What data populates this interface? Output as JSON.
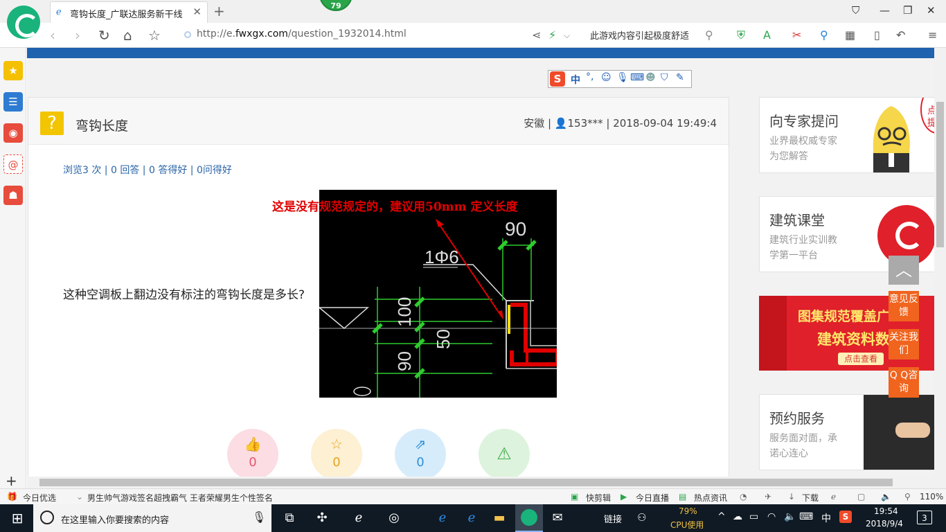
{
  "browser": {
    "tab_title": "弯钩长度_广联达服务新干线",
    "badge": "79",
    "url_prefix": "http://e.",
    "url_domain": "fwxgx.com",
    "url_path": "/question_1932014.html",
    "search_text": "此游戏内容引起极度舒适"
  },
  "question": {
    "title": "弯钩长度",
    "region": "安徽",
    "user": "153***",
    "datetime": "2018-09-04 19:49:4",
    "views": "浏览3 次",
    "answers": "0 回答",
    "good_answers": "0 答得好",
    "good_questions": "0问得好",
    "body": "这种空调板上翻边没有标注的弯钩长度是多长?",
    "annotation": "这是没有规范规定的，建议用50mm 定义长度",
    "like_count": "0",
    "fav_count": "0",
    "share_count": "0"
  },
  "cad": {
    "dim_90_top": "90",
    "rebar_label": "1Φ6",
    "dim_100": "100",
    "dim_50": "50",
    "dim_90_left": "90"
  },
  "sidebar_cards": [
    {
      "title": "向专家提问",
      "sub1": "业界最权威专家",
      "sub2": "为您解答"
    },
    {
      "title": "建筑课堂",
      "sub1": "建筑行业实训教",
      "sub2": "学第一平台"
    },
    {
      "title": "预约服务",
      "sub1": "服务面对面，承",
      "sub2": "诺心连心"
    }
  ],
  "mascot_bubble": "点击\n提问",
  "banner": {
    "line1": "图集规范覆盖广",
    "line2": "建筑资料数",
    "cta": "点击查看"
  },
  "float_buttons": {
    "feedback": "意见反馈",
    "follow": "关注我们",
    "qq": "Q Q咨询"
  },
  "statusbar": {
    "today": "今日优选",
    "headline": "男生帅气游戏签名超拽霸气 王者荣耀男生个性签名",
    "clip": "快剪辑",
    "live": "今日直播",
    "news": "热点资讯",
    "download": "下载",
    "zoom": "110%"
  },
  "taskbar": {
    "search_placeholder": "在这里输入你要搜索的内容",
    "link": "链接",
    "cpu_pct": "79%",
    "cpu_label": "CPU使用",
    "ime": "中",
    "time": "19:54",
    "date": "2018/9/4",
    "notif": "3"
  },
  "colors": {
    "accent_blue": "#1f62ad",
    "annotation_red": "#e00000",
    "float_orange": "#f0641e"
  }
}
